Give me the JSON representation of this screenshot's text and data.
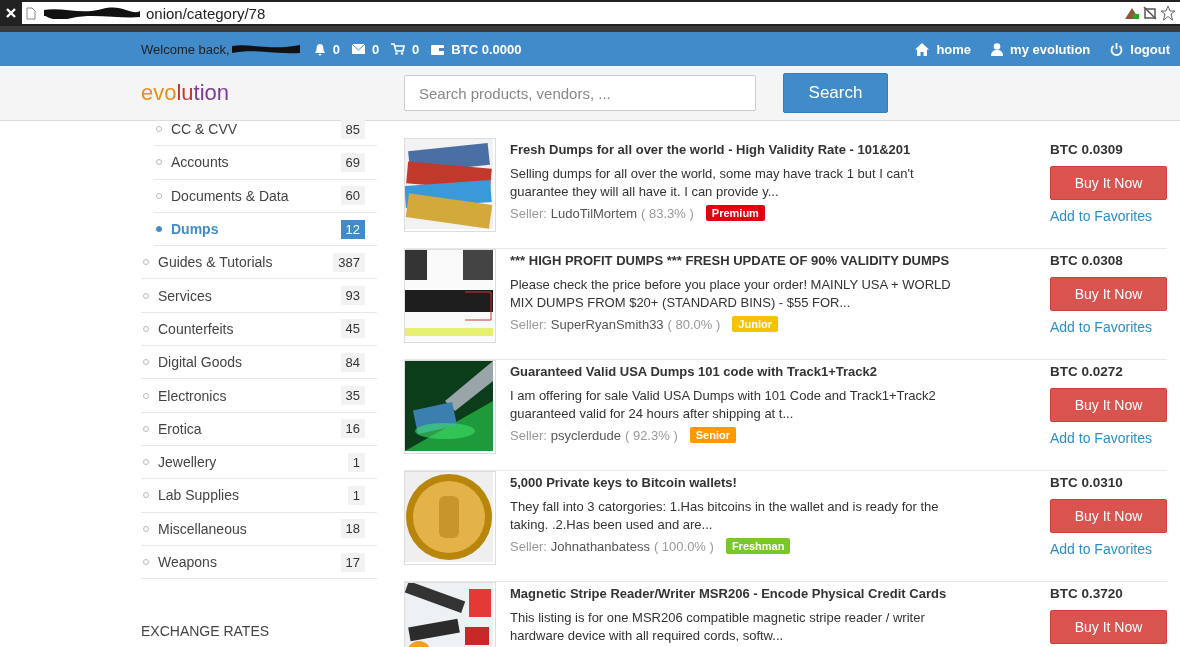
{
  "browser": {
    "address": "onion/category/78"
  },
  "navbar": {
    "welcome": "Welcome back,",
    "counters": [
      {
        "kind": "bell",
        "value": "0"
      },
      {
        "kind": "mail",
        "value": "0"
      },
      {
        "kind": "cart",
        "value": "0"
      },
      {
        "kind": "wallet",
        "value": "BTC 0.0000"
      }
    ],
    "links": [
      {
        "kind": "home",
        "label": "home"
      },
      {
        "kind": "user",
        "label": "my evolution"
      },
      {
        "kind": "power",
        "label": "logout"
      }
    ]
  },
  "header": {
    "logo": [
      {
        "text": "evo",
        "color": "#e8901c"
      },
      {
        "text": "lu",
        "color": "#c0392b"
      },
      {
        "text": "tion",
        "color": "#7d3c98"
      }
    ],
    "search": {
      "placeholder": "Search products, vendors, ..."
    },
    "search_button": "Search"
  },
  "sidebar": {
    "subitems": [
      {
        "label": "CC & CVV",
        "count": "85",
        "selected": false
      },
      {
        "label": "Accounts",
        "count": "69",
        "selected": false
      },
      {
        "label": "Documents & Data",
        "count": "60",
        "selected": false
      },
      {
        "label": "Dumps",
        "count": "12",
        "selected": true
      }
    ],
    "items": [
      {
        "label": "Guides & Tutorials",
        "count": "387",
        "selected": false
      },
      {
        "label": "Services",
        "count": "93",
        "selected": false
      },
      {
        "label": "Counterfeits",
        "count": "45",
        "selected": false
      },
      {
        "label": "Digital Goods",
        "count": "84",
        "selected": false
      },
      {
        "label": "Electronics",
        "count": "35",
        "selected": false
      },
      {
        "label": "Erotica",
        "count": "16",
        "selected": false
      },
      {
        "label": "Jewellery",
        "count": "1",
        "selected": false
      },
      {
        "label": "Lab Supplies",
        "count": "1",
        "selected": false
      },
      {
        "label": "Miscellaneous",
        "count": "18",
        "selected": false
      },
      {
        "label": "Weapons",
        "count": "17",
        "selected": false
      }
    ],
    "exchange_heading": "EXCHANGE RATES"
  },
  "listings": [
    {
      "kind": "cards",
      "title": "Fresh Dumps for all over the world - High Validity Rate - 101&201",
      "description": "Selling dumps for all over the world, some may have track 1 but I can't guarantee they will all have it. I can provide y...",
      "seller_label": "Seller:",
      "seller": "LudoTilMortem",
      "rating": "( 83.3% )",
      "badge": "Premium",
      "color": "#e3000f",
      "price": "BTC 0.0309",
      "buy": "Buy It Now",
      "favorite": "Add to Favorites"
    },
    {
      "kind": "device",
      "title": "*** HIGH PROFIT DUMPS *** FRESH UPDATE OF 90% VALIDITY DUMPS",
      "description": "Please check the price before you place your order! MAINLY USA + WORLD MIX DUMPS FROM $20+ (STANDARD BINS) - $55 FOR...",
      "seller_label": "Seller:",
      "seller": "SuperRyanSmith33",
      "rating": "( 80.0% )",
      "badge": "Junior",
      "color": "#f5c400",
      "price": "BTC 0.0308",
      "buy": "Buy It Now",
      "favorite": "Add to Favorites"
    },
    {
      "kind": "hand",
      "title": "Guaranteed Valid USA Dumps 101 code with Track1+Track2",
      "description": "I am offering for sale Valid USA Dumps with 101 Code and Track1+Track2 guaranteed valid for 24 hours after shipping at t...",
      "seller_label": "Seller:",
      "seller": "psyclerdude",
      "rating": "( 92.3% )",
      "badge": "Senior",
      "color": "#ff9900",
      "price": "BTC 0.0272",
      "buy": "Buy It Now",
      "favorite": "Add to Favorites"
    },
    {
      "kind": "coin",
      "title": "5,000 Private keys to Bitcoin wallets!",
      "description": "They fall into 3 catorgories: 1.Has bitcoins in the wallet and is ready for the taking. .2.Has been used and are...",
      "seller_label": "Seller:",
      "seller": "Johnathanbatess",
      "rating": "( 100.0% )",
      "badge": "Freshman",
      "color": "#7ac728",
      "price": "BTC 0.0310",
      "buy": "Buy It Now",
      "favorite": "Add to Favorites"
    },
    {
      "kind": "reader",
      "title": "Magnetic Stripe Reader/Writer MSR206 - Encode Physical Credit Cards",
      "description": "This listing is for one MSR206 compatible magnetic stripe reader / writer hardware device with all required cords, softw...",
      "price": "BTC 0.3720",
      "buy": "Buy It Now"
    }
  ]
}
